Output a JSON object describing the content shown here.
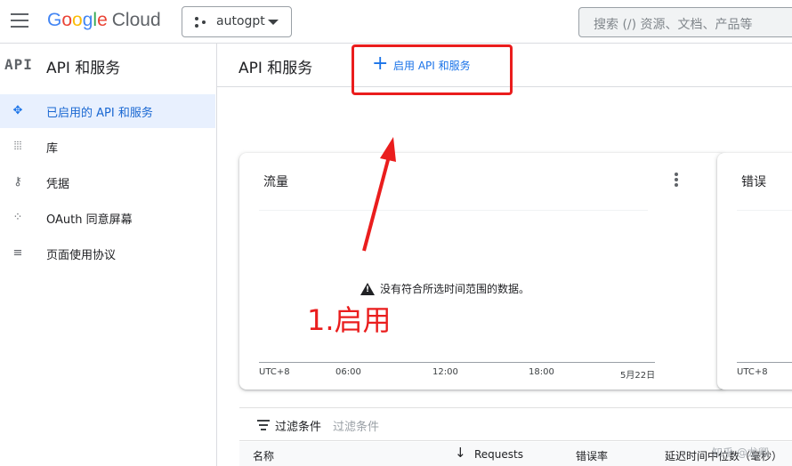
{
  "topbar": {
    "logo_google": "Google",
    "logo_cloud": "Cloud",
    "project_name": "autogpt",
    "search_placeholder": "搜索 (/) 资源、文档、产品等"
  },
  "sidebar": {
    "logo_text": "API",
    "title": "API 和服务",
    "items": [
      {
        "label": "已启用的 API 和服务",
        "icon": "api-diamond-icon",
        "active": true
      },
      {
        "label": "库",
        "icon": "library-icon",
        "active": false
      },
      {
        "label": "凭据",
        "icon": "key-icon",
        "active": false
      },
      {
        "label": "OAuth 同意屏幕",
        "icon": "oauth-dots-icon",
        "active": false
      },
      {
        "label": "页面使用协议",
        "icon": "page-settings-icon",
        "active": false
      }
    ]
  },
  "main": {
    "title": "API 和服务",
    "enable_button": "启用 API 和服务"
  },
  "traffic_card": {
    "title": "流量",
    "no_data": "没有符合所选时间范围的数据。",
    "ticks": [
      "UTC+8",
      "06:00",
      "12:00",
      "18:00",
      "5月22日"
    ]
  },
  "errors_card": {
    "title": "错误",
    "tick": "UTC+8"
  },
  "annotation": {
    "label": "1.启用",
    "color": "#ea1d1d"
  },
  "filter": {
    "label": "过滤条件",
    "placeholder": "过滤条件"
  },
  "table": {
    "columns": [
      "名称",
      "Requests",
      "错误率",
      "延迟时间中位数（毫秒）"
    ]
  },
  "watermark": "知乎 @龙卿"
}
